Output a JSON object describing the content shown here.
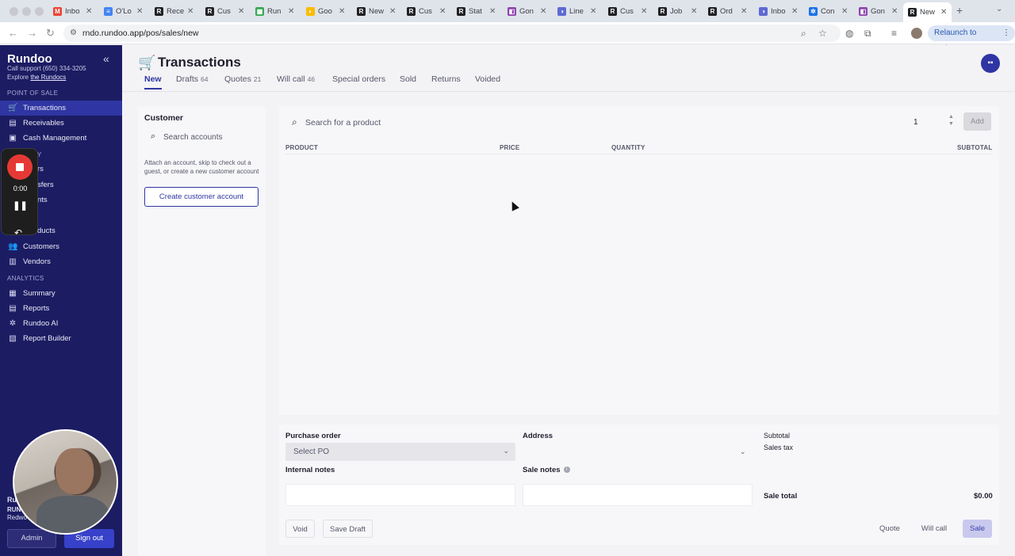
{
  "browser": {
    "tabs": [
      {
        "label": "Inbo",
        "color": "#ea4335",
        "glyph": "M"
      },
      {
        "label": "O'Lo",
        "color": "#4285f4",
        "glyph": "≡"
      },
      {
        "label": "Rece",
        "color": "#202124",
        "glyph": "R"
      },
      {
        "label": "Cus",
        "color": "#202124",
        "glyph": "R"
      },
      {
        "label": "Run",
        "color": "#34a853",
        "glyph": "▦"
      },
      {
        "label": "Goo",
        "color": "#fbbc04",
        "glyph": "◐"
      },
      {
        "label": "New",
        "color": "#202124",
        "glyph": "R"
      },
      {
        "label": "Cus",
        "color": "#202124",
        "glyph": "R"
      },
      {
        "label": "Stat",
        "color": "#202124",
        "glyph": "R"
      },
      {
        "label": "Gon",
        "color": "#8e44ad",
        "glyph": "◧"
      },
      {
        "label": "Line",
        "color": "#5e6ad2",
        "glyph": "◑"
      },
      {
        "label": "Cus",
        "color": "#202124",
        "glyph": "R"
      },
      {
        "label": "Job",
        "color": "#202124",
        "glyph": "R"
      },
      {
        "label": "Ord",
        "color": "#202124",
        "glyph": "R"
      },
      {
        "label": "Inbo",
        "color": "#5e6ad2",
        "glyph": "◑"
      },
      {
        "label": "Con",
        "color": "#1a73e8",
        "glyph": "✲"
      },
      {
        "label": "Gon",
        "color": "#8e44ad",
        "glyph": "◧"
      },
      {
        "label": "New",
        "color": "#202124",
        "glyph": "R"
      }
    ],
    "url": "rndo.rundoo.app/pos/sales/new",
    "relaunch_label": "Relaunch to update"
  },
  "sidebar": {
    "brand": "Rundoo",
    "support": "Call support (650) 334-3205",
    "explore_prefix": "Explore",
    "explore_link": "the Rundocs",
    "section_pos": "POINT OF SALE",
    "section_inventory_partial": "Y",
    "section_analytics": "ANALYTICS",
    "items": [
      {
        "label": "Transactions",
        "icon": "🛒"
      },
      {
        "label": "Receivables",
        "icon": "▤"
      },
      {
        "label": "Cash Management",
        "icon": "▣"
      },
      {
        "label": "rs",
        "icon": ""
      },
      {
        "label": "sfers",
        "icon": ""
      },
      {
        "label": "nts",
        "icon": ""
      },
      {
        "label": "ducts",
        "icon": ""
      },
      {
        "label": "Customers",
        "icon": "👥"
      },
      {
        "label": "Vendors",
        "icon": "▥"
      },
      {
        "label": "Summary",
        "icon": "▦"
      },
      {
        "label": "Reports",
        "icon": "▤"
      },
      {
        "label": "Rundoo AI",
        "icon": "✲"
      },
      {
        "label": "Report Builder",
        "icon": "▧"
      }
    ],
    "user_initials": "Ru",
    "user_line2": "RUN",
    "user_line3": "Redwo",
    "admin_label": "Admin",
    "signout_label": "Sign out"
  },
  "recorder": {
    "time": "0:00"
  },
  "page": {
    "title": "Transactions",
    "tabs": [
      {
        "label": "New",
        "count": ""
      },
      {
        "label": "Drafts",
        "count": "64"
      },
      {
        "label": "Quotes",
        "count": "21"
      },
      {
        "label": "Will call",
        "count": "46"
      },
      {
        "label": "Special orders",
        "count": ""
      },
      {
        "label": "Sold",
        "count": ""
      },
      {
        "label": "Returns",
        "count": ""
      },
      {
        "label": "Voided",
        "count": ""
      }
    ]
  },
  "customer": {
    "title": "Customer",
    "search_placeholder": "Search accounts",
    "help": "Attach an account, skip to check out a guest, or create a new customer account",
    "create_label": "Create customer account"
  },
  "products": {
    "search_placeholder": "Search for a product",
    "quantity": "1",
    "add_label": "Add",
    "columns": [
      "PRODUCT",
      "PRICE",
      "QUANTITY",
      "SUBTOTAL"
    ]
  },
  "sale": {
    "po_label": "Purchase order",
    "po_value": "Select PO",
    "address_label": "Address",
    "subtotal_label": "Subtotal",
    "sales_tax_label": "Sales tax",
    "internal_notes_label": "Internal notes",
    "sale_notes_label": "Sale notes",
    "sale_total_label": "Sale total",
    "sale_total_value": "$0.00",
    "void_label": "Void",
    "save_draft_label": "Save Draft",
    "quote_label": "Quote",
    "will_call_label": "Will call",
    "sale_label": "Sale"
  }
}
